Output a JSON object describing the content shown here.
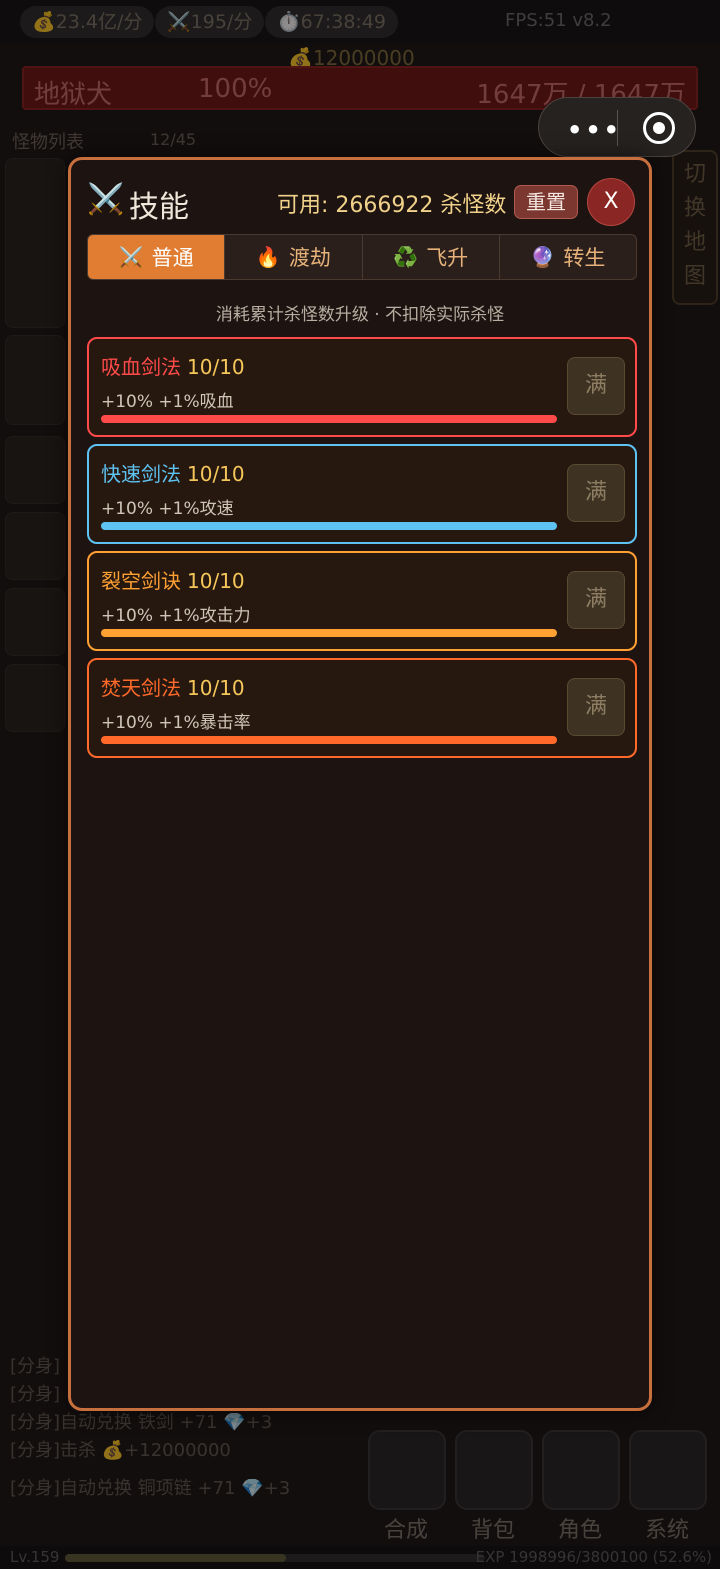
{
  "topbar": {
    "gold_rate": "💰23.4亿/分",
    "kill_rate": "⚔️195/分",
    "timer": "⏱️67:38:49",
    "fps": "FPS:51 v8.2"
  },
  "boss": {
    "gold_label": "💰12000000",
    "name": "地狱犬",
    "percent": "100%",
    "hp": "1647万 / 1647万"
  },
  "background": {
    "monster_list_label": "怪物列表",
    "monster_count": "12/45",
    "map_switch": "切换地图",
    "logs": [
      "[分身]",
      "[分身]",
      "[分身]自动兑换 铁剑 +71 💎+3",
      "[分身]击杀 💰+12000000",
      "[分身]自动兑换 铜项链 +71 💎+3"
    ],
    "bottom_buttons": [
      "合成",
      "背包",
      "角色",
      "系统"
    ],
    "level": "Lv.159",
    "exp": "EXP 1998996/3800100 (52.6%)",
    "exp_progress": 0.526
  },
  "modal": {
    "title": "技能",
    "available": "可用: 2666922 杀怪数",
    "reset_label": "重置",
    "close_label": "X",
    "tabs": [
      {
        "icon": "⚔️",
        "label": "普通"
      },
      {
        "icon": "🔥",
        "label": "渡劫"
      },
      {
        "icon": "♻️",
        "label": "飞升"
      },
      {
        "icon": "🔮",
        "label": "转生"
      }
    ],
    "hint": "消耗累计杀怪数升级 · 不扣除实际杀怪",
    "skills": [
      {
        "name": "吸血剑法",
        "level": "10/10",
        "desc": "+10% +1%吸血",
        "max_label": "满",
        "color": "#ff4a4a",
        "progress": 1.0
      },
      {
        "name": "快速剑法",
        "level": "10/10",
        "desc": "+10% +1%攻速",
        "max_label": "满",
        "color": "#5ec2f2",
        "progress": 1.0
      },
      {
        "name": "裂空剑诀",
        "level": "10/10",
        "desc": "+10% +1%攻击力",
        "max_label": "满",
        "color": "#ffa033",
        "progress": 1.0
      },
      {
        "name": "焚天剑法",
        "level": "10/10",
        "desc": "+10% +1%暴击率",
        "max_label": "满",
        "color": "#ff6a2a",
        "progress": 1.0
      }
    ]
  }
}
